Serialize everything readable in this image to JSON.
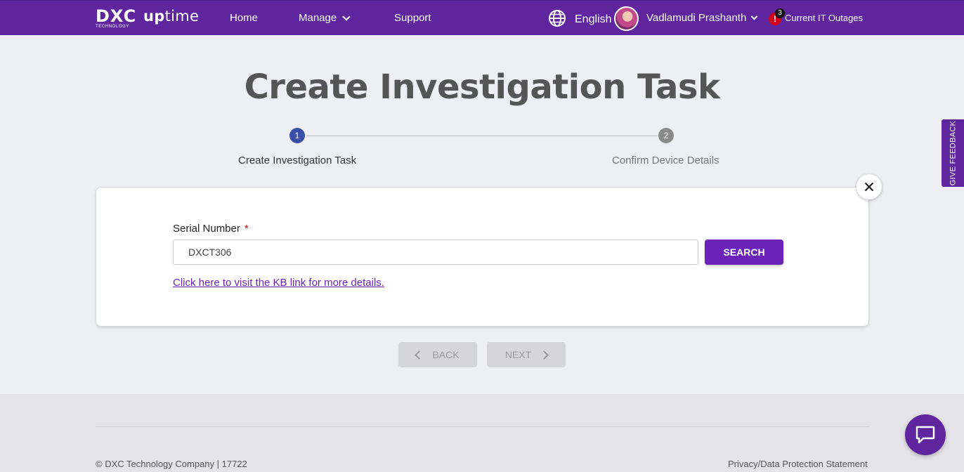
{
  "header": {
    "logo_text": "DXC",
    "logo_subtext": "TECHNOLOGY",
    "app_name_bold": "up",
    "app_name_rest": "time",
    "nav": {
      "home": "Home",
      "manage": "Manage",
      "support": "Support"
    },
    "language": "English",
    "user_name": "Vadlamudi Prashanth",
    "alert_badge_count": "3",
    "alert_icon_glyph": "!",
    "outages_label": "Current IT Outages",
    "brand_color": "#5f259f"
  },
  "page": {
    "title": "Create Investigation Task"
  },
  "stepper": {
    "steps": [
      {
        "number": "1",
        "label": "Create Investigation Task",
        "state": "active",
        "color": "#3a4fa8"
      },
      {
        "number": "2",
        "label": "Confirm Device Details",
        "state": "inactive",
        "color": "#8a8a8a"
      }
    ]
  },
  "form": {
    "serial_label": "Serial Number",
    "required_marker": "*",
    "serial_value": "DXCT306",
    "search_button": "SEARCH",
    "kb_link": "Click here to visit the KB link for more details."
  },
  "navigation": {
    "back": "BACK",
    "next": "NEXT"
  },
  "feedback_tab": "GIVE FEEDBACK",
  "footer": {
    "copyright": "© DXC Technology Company | 17722",
    "privacy": "Privacy/Data Protection Statement"
  },
  "icons": {
    "globe": "globe-icon",
    "close": "close-icon",
    "chat": "chat-icon",
    "alert": "alert-icon",
    "chevron": "chevron-down-icon"
  }
}
